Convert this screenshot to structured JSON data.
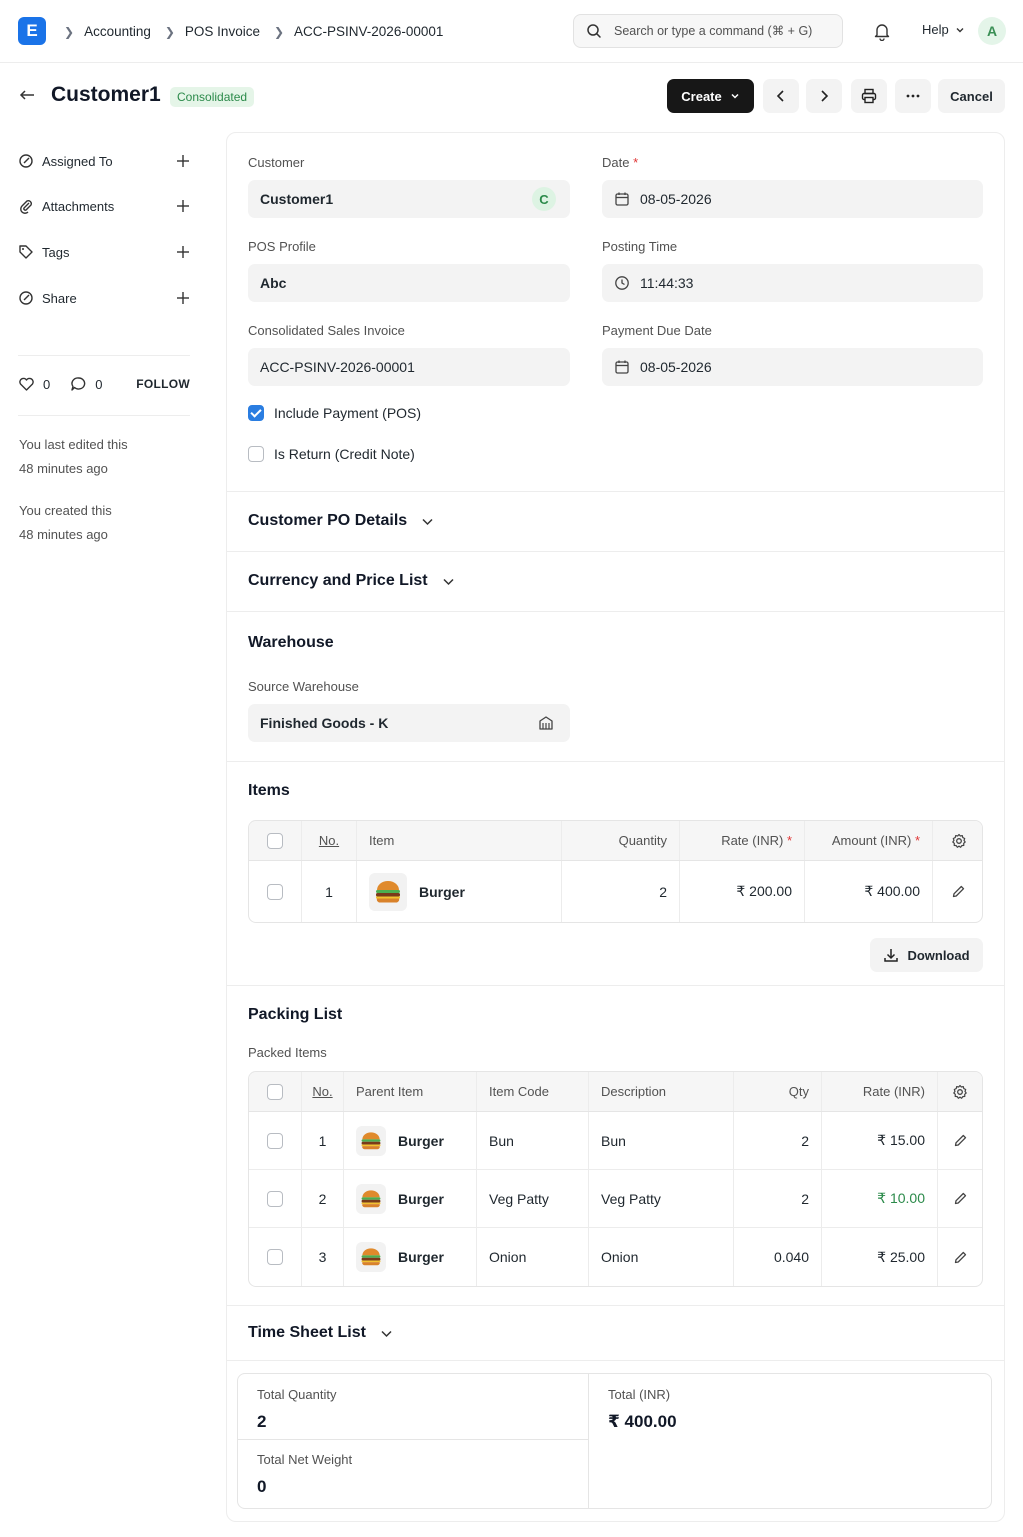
{
  "colors": {
    "accent": "#1a73e8",
    "primary_button": "#171717",
    "success": "#2b8a4a",
    "required": "#e03636"
  },
  "navbar": {
    "logo_letter": "E",
    "breadcrumbs": [
      "Accounting",
      "POS Invoice",
      "ACC-PSINV-2026-00001"
    ],
    "search_placeholder": "Search or type a command (⌘ + G)",
    "help_label": "Help",
    "avatar_letter": "A"
  },
  "header": {
    "title": "Customer1",
    "status": "Consolidated",
    "create_label": "Create",
    "cancel_label": "Cancel"
  },
  "sidebar": {
    "items": [
      {
        "label": "Assigned To",
        "icon": "assign-icon"
      },
      {
        "label": "Attachments",
        "icon": "paperclip-icon"
      },
      {
        "label": "Tags",
        "icon": "tag-icon"
      },
      {
        "label": "Share",
        "icon": "share-icon"
      }
    ],
    "likes": "0",
    "comments": "0",
    "follow_label": "FOLLOW",
    "edited_line1": "You last edited this",
    "edited_line2": "48 minutes ago",
    "created_line1": "You created this",
    "created_line2": "48 minutes ago"
  },
  "form": {
    "customer_label": "Customer",
    "customer_value": "Customer1",
    "customer_pill": "C",
    "date_label": "Date",
    "date_value": "08-05-2026",
    "pos_profile_label": "POS Profile",
    "pos_profile_value": "Abc",
    "posting_time_label": "Posting Time",
    "posting_time_value": "11:44:33",
    "consolidated_label": "Consolidated Sales Invoice",
    "consolidated_value": "ACC-PSINV-2026-00001",
    "due_date_label": "Payment Due Date",
    "due_date_value": "08-05-2026",
    "include_payment_label": "Include Payment (POS)",
    "include_payment_checked": true,
    "is_return_label": "Is Return (Credit Note)",
    "is_return_checked": false
  },
  "sections": {
    "customer_po": "Customer PO Details",
    "currency": "Currency and Price List",
    "warehouse": "Warehouse",
    "source_warehouse_label": "Source Warehouse",
    "source_warehouse_value": "Finished Goods - K",
    "items": "Items",
    "packing": "Packing List",
    "packed_items_label": "Packed Items",
    "timesheet": "Time Sheet List",
    "download_label": "Download"
  },
  "items_table": {
    "headers": [
      "No.",
      "Item",
      "Quantity",
      "Rate (INR)",
      "Amount (INR)"
    ],
    "rows": [
      {
        "no": "1",
        "item": "Burger",
        "qty": "2",
        "rate": "₹ 200.00",
        "amount": "₹ 400.00"
      }
    ]
  },
  "packed_table": {
    "headers": [
      "No.",
      "Parent Item",
      "Item Code",
      "Description",
      "Qty",
      "Rate (INR)"
    ],
    "rows": [
      {
        "no": "1",
        "parent": "Burger",
        "code": "Bun",
        "desc": "Bun",
        "qty": "2",
        "rate": "₹ 15.00"
      },
      {
        "no": "2",
        "parent": "Burger",
        "code": "Veg Patty",
        "desc": "Veg Patty",
        "qty": "2",
        "rate": "₹ 10.00"
      },
      {
        "no": "3",
        "parent": "Burger",
        "code": "Onion",
        "desc": "Onion",
        "qty": "0.040",
        "rate": "₹ 25.00"
      }
    ]
  },
  "totals": {
    "total_qty_label": "Total Quantity",
    "total_qty_value": "2",
    "total_label": "Total (INR)",
    "total_value": "₹ 400.00",
    "net_weight_label": "Total Net Weight",
    "net_weight_value": "0"
  }
}
